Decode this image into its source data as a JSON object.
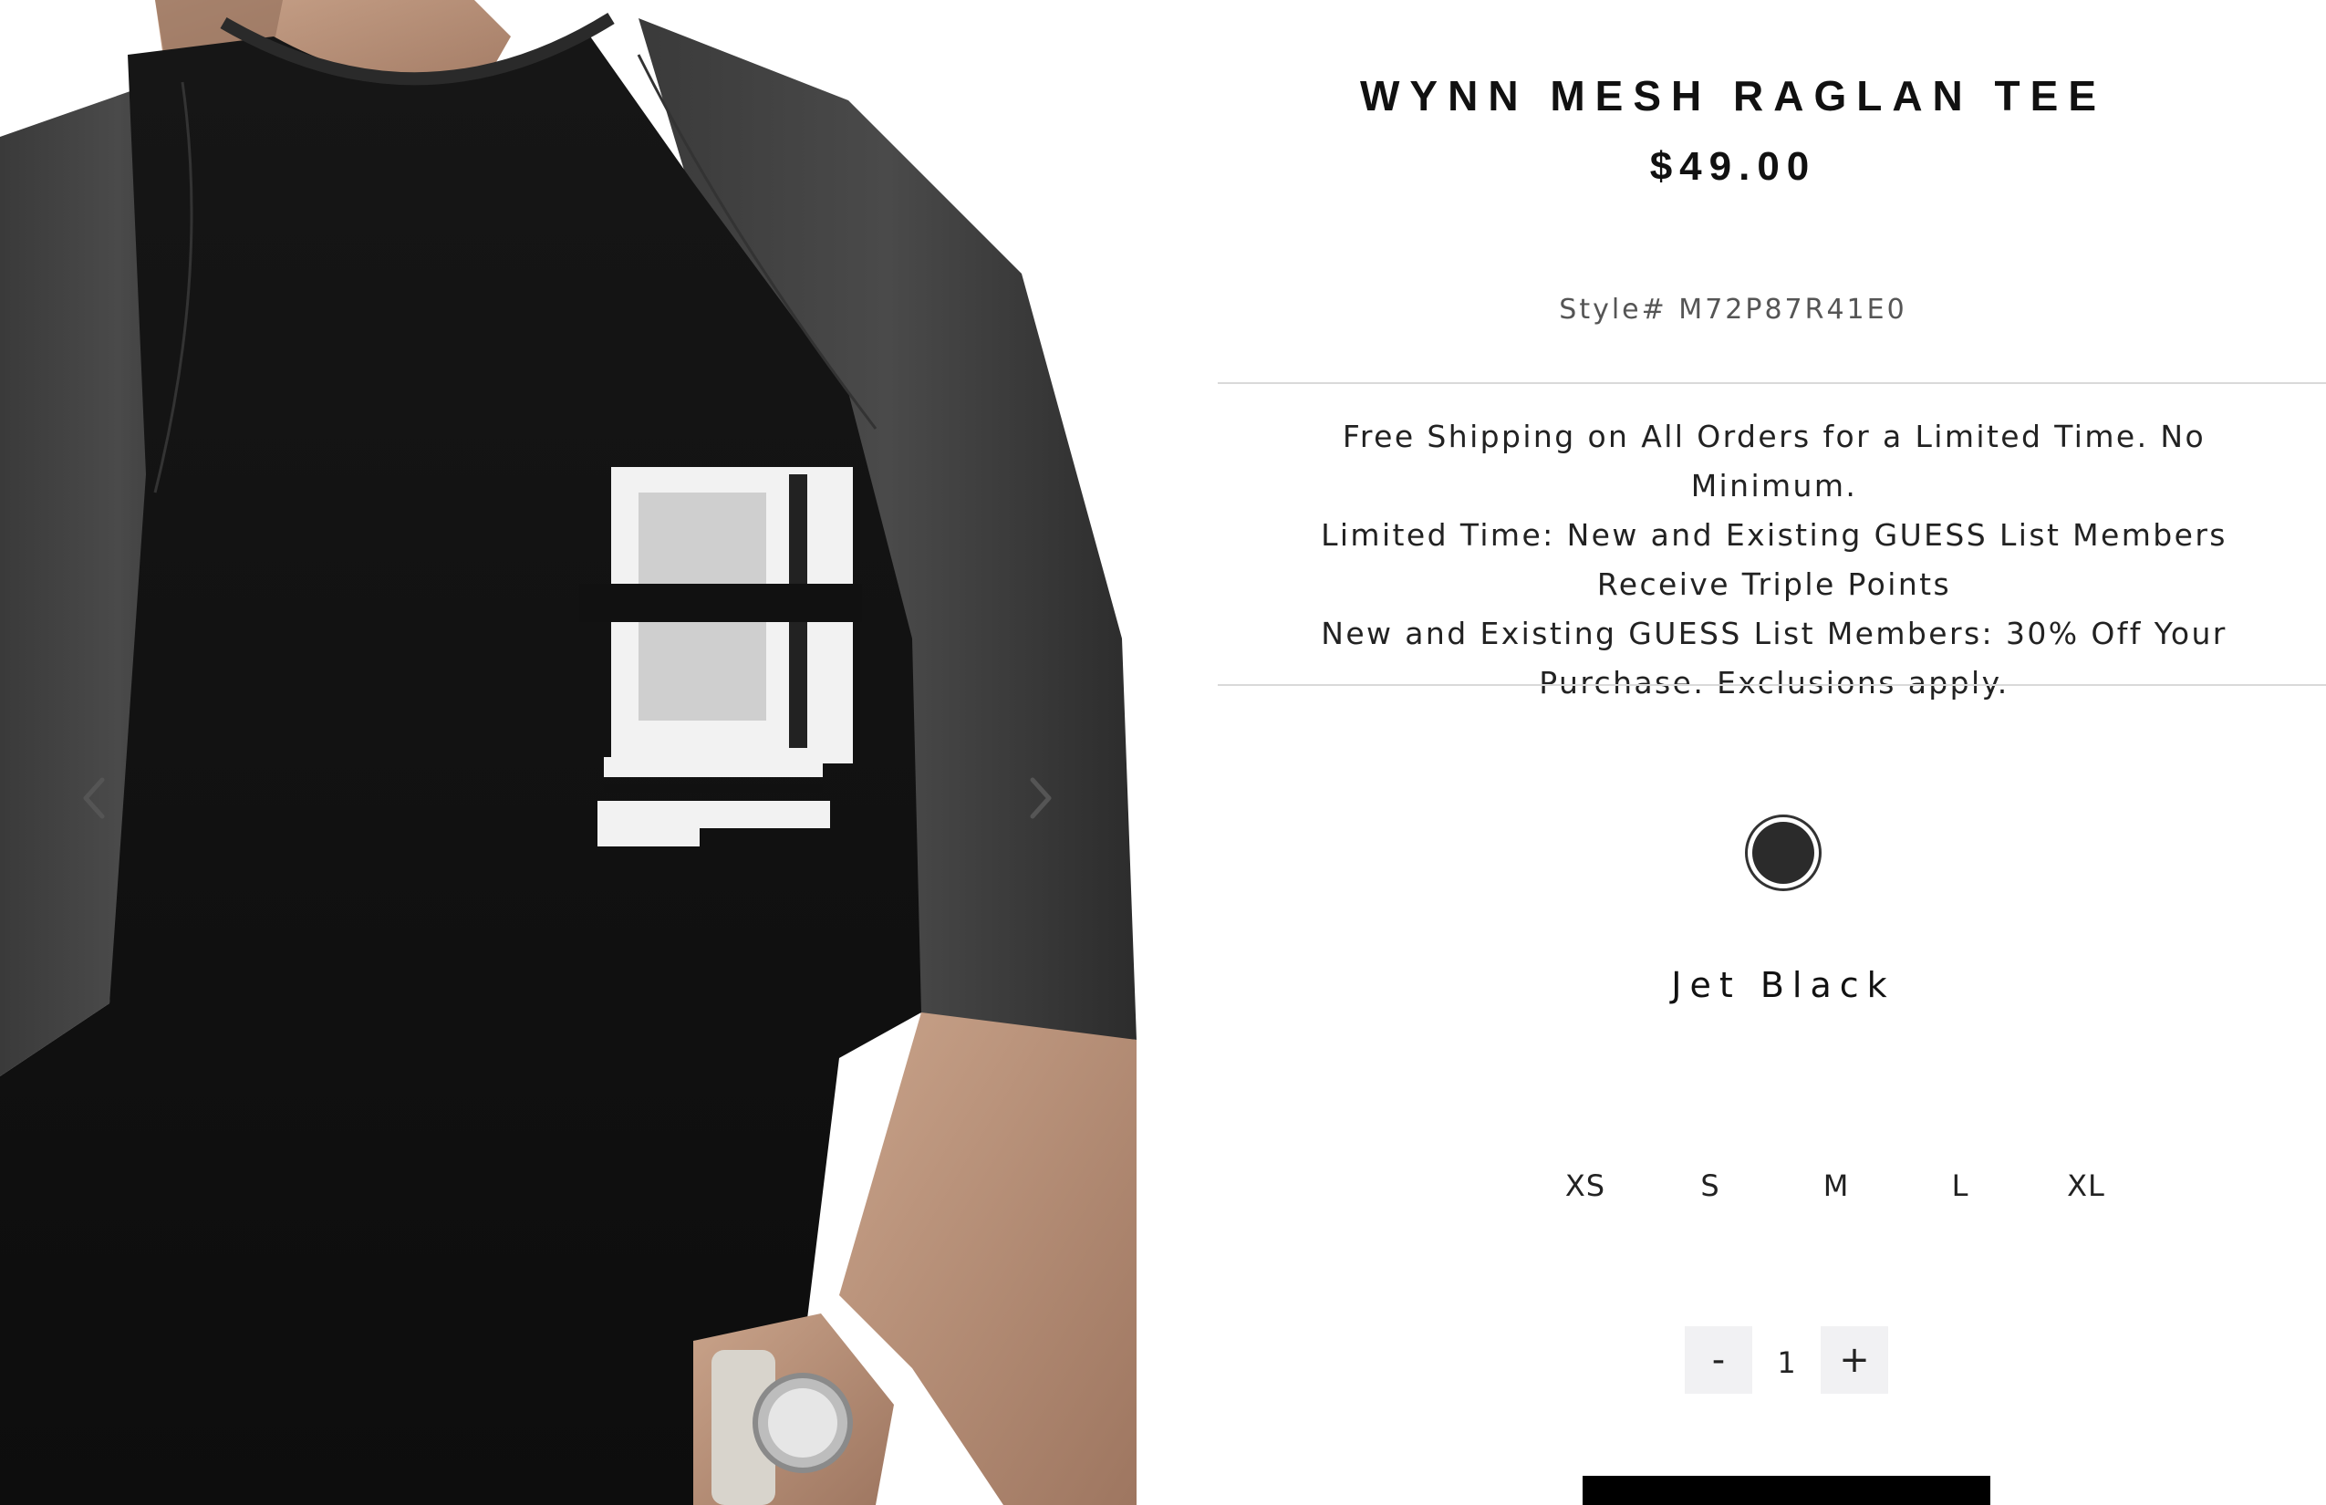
{
  "product": {
    "title": "WYNN MESH RAGLAN TEE",
    "price": "$49.00",
    "style_number": "Style# M72P87R41E0"
  },
  "promotions": [
    "Free Shipping on All Orders for a Limited Time. No Minimum.",
    "Limited Time: New and Existing GUESS List Members Receive Triple Points",
    "New and Existing GUESS List Members: 30% Off Your Purchase. Exclusions apply."
  ],
  "color": {
    "selected_name": "Jet Black",
    "swatch_hex": "#2b2b2b"
  },
  "sizes": [
    "XS",
    "S",
    "M",
    "L",
    "XL"
  ],
  "quantity": {
    "decrement_label": "-",
    "value": "1",
    "increment_label": "+"
  },
  "gallery": {
    "prev_icon": "chevron-left-icon",
    "next_icon": "chevron-right-icon"
  }
}
